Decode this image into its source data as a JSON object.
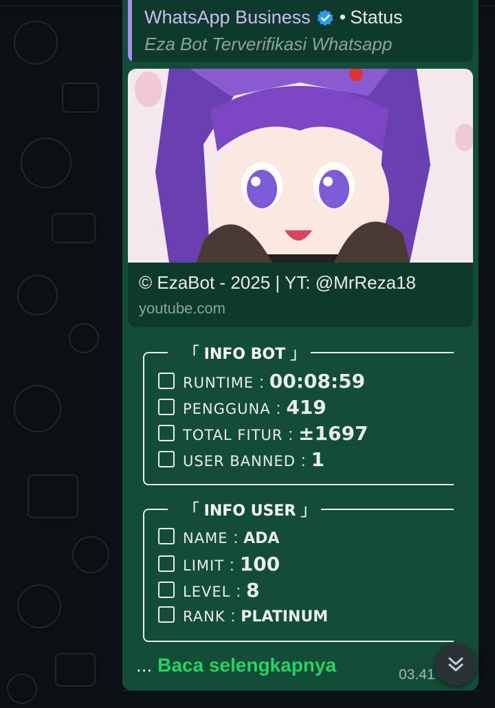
{
  "quote": {
    "title": "WhatsApp Business",
    "separator": "•",
    "status": "Status",
    "subtitle": "Eza Bot Terverifikasi Whatsapp"
  },
  "link_preview": {
    "title": "© EzaBot - 2025 | YT: @MrReza18",
    "domain": "youtube.com"
  },
  "info_bot": {
    "heading_open": "「",
    "heading": "INFO BOT",
    "heading_close": "」",
    "rows": [
      {
        "label": "RUNTIME",
        "value": "00:08:59"
      },
      {
        "label": "PENGGUNA",
        "value": "419"
      },
      {
        "label": "TOTAL FITUR",
        "value": "±1697"
      },
      {
        "label": "USER BANNED",
        "value": "1"
      }
    ]
  },
  "info_user": {
    "heading_open": "「",
    "heading": "INFO USER",
    "heading_close": "」",
    "rows": [
      {
        "label": "NAME",
        "value": "ADA"
      },
      {
        "label": "LIMIT",
        "value": "100"
      },
      {
        "label": "LEVEL",
        "value": "8"
      },
      {
        "label": "RANK",
        "value": "PLATINUM"
      }
    ]
  },
  "colon": ":",
  "read_more": {
    "ellipsis": "...",
    "label": "Baca selengkapnya"
  },
  "timestamp": "03.41",
  "colors": {
    "bubble": "#144d37",
    "accent_green": "#25d366",
    "quote_bar": "#a791f0",
    "verified": "#2b9bf0"
  },
  "icons": {
    "verified": "verified-badge-icon",
    "row_bullet": "square-icon",
    "scroll_down": "double-chevron-down-icon"
  }
}
